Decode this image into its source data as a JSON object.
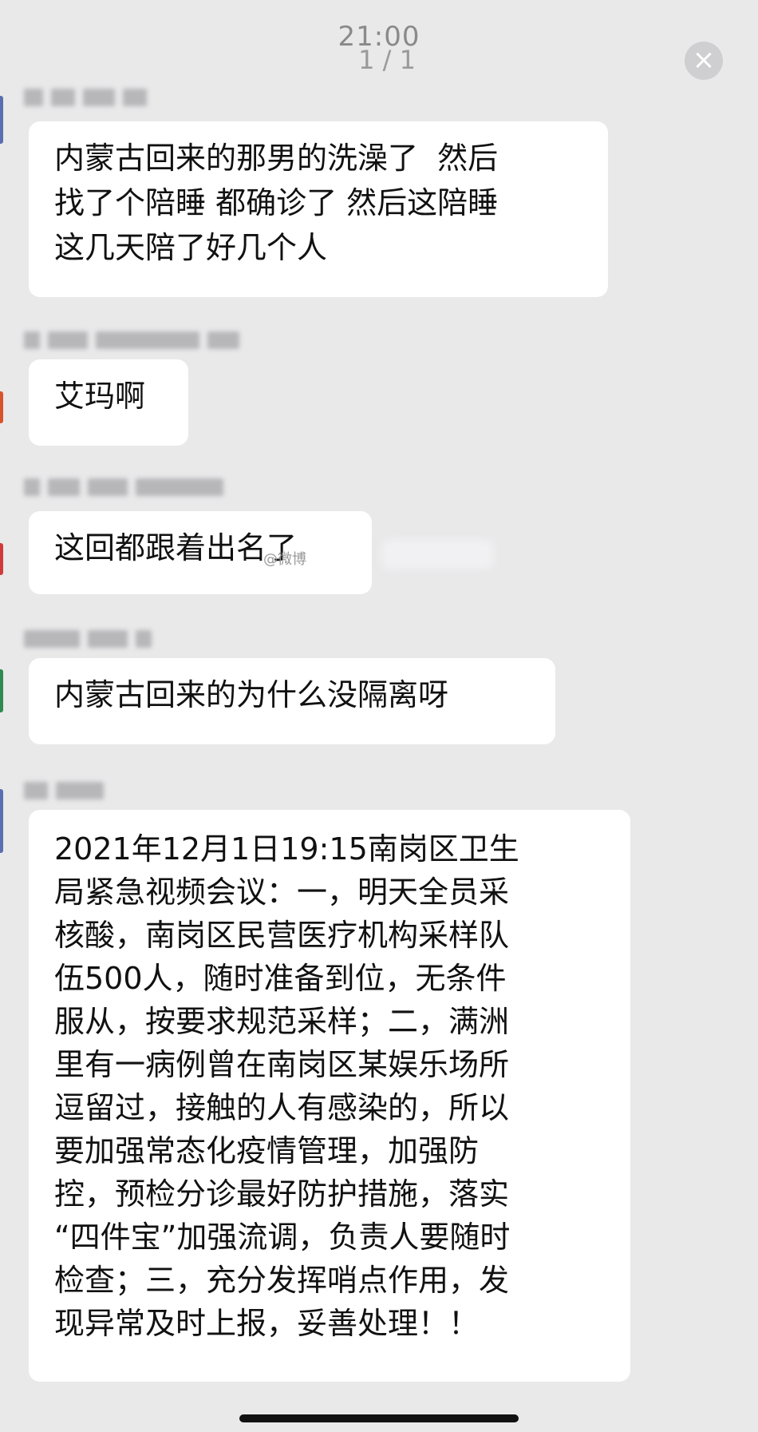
{
  "status": {
    "time": "21:00"
  },
  "viewer": {
    "page_indicator": "1 / 1",
    "close_icon": "×"
  },
  "messages": [
    {
      "text": "内蒙古回来的那男的洗澡了  然后\n找了个陪睡 都确诊了 然后这陪睡\n这几天陪了好几个人"
    },
    {
      "text": "艾玛啊"
    },
    {
      "text": "这回都跟着出名了"
    },
    {
      "text": "内蒙古回来的为什么没隔离呀"
    },
    {
      "text": "2021年12月1日19:15南岗区卫生\n局紧急视频会议：一，明天全员采\n核酸，南岗区民营医疗机构采样队\n伍500人，随时准备到位，无条件\n服从，按要求规范采样；二，满洲\n里有一病例曾在南岗区某娱乐场所\n逗留过，接触的人有感染的，所以\n要加强常态化疫情管理，加强防\n控，预检分诊最好防护措施，落实\n“四件宝”加强流调，负责人要随时\n检查；三，充分发挥哨点作用，发\n现异常及时上报，妥善处理！！"
    }
  ],
  "watermark": {
    "text": "@微博"
  },
  "colors": {
    "background": "#e9e9ea",
    "bubble": "#ffffff",
    "text": "#111111"
  }
}
